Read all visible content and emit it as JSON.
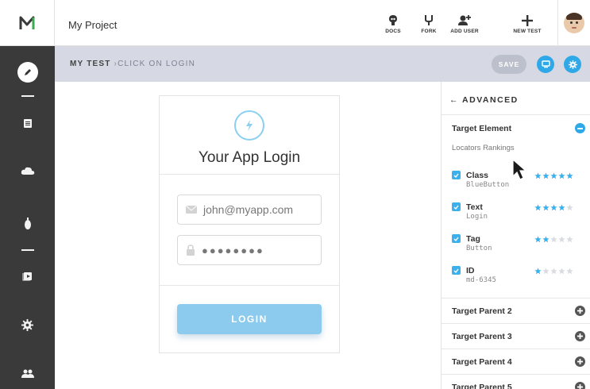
{
  "window": {
    "project_title": "My Project"
  },
  "toolbar": {
    "docs_label": "DOCS",
    "fork_label": "FORK",
    "add_user_label": "ADD USER",
    "new_test_label": "NEW TEST"
  },
  "sidebar": {
    "items": [
      {
        "icon": "pencil-icon"
      },
      {
        "icon": "document-icon"
      },
      {
        "icon": "cloud-icon"
      },
      {
        "icon": "bug-icon"
      },
      {
        "icon": "media-icon"
      },
      {
        "icon": "gear-icon"
      },
      {
        "icon": "users-icon"
      }
    ]
  },
  "subheader": {
    "breadcrumb_root": "MY TEST",
    "breadcrumb_sep": "›",
    "breadcrumb_current": "CLICK ON LOGIN",
    "save_label": "SAVE"
  },
  "login_card": {
    "title": "Your App Login",
    "email_value": "john@myapp.com",
    "password_value": "●●●●●●●●",
    "login_label": "LOGIN"
  },
  "panel": {
    "back_label": "← ADVANCED",
    "target_element_title": "Target Element",
    "locators_label": "Locators Rankings",
    "locators": [
      {
        "name": "Class",
        "value": "BlueButton",
        "rating": 5,
        "checked": true
      },
      {
        "name": "Text",
        "value": "Login",
        "rating": 4,
        "checked": true
      },
      {
        "name": "Tag",
        "value": "Button",
        "rating": 2,
        "checked": true
      },
      {
        "name": "ID",
        "value": "md-6345",
        "rating": 1,
        "checked": true
      }
    ],
    "parents": [
      {
        "label": "Target Parent 2"
      },
      {
        "label": "Target Parent 3"
      },
      {
        "label": "Target Parent 4"
      },
      {
        "label": "Target Parent 5"
      }
    ]
  },
  "colors": {
    "accent": "#2fa8e8",
    "star_on": "#3ab0ec",
    "star_off": "#d9dbe0",
    "sidebar": "#3a3a3a",
    "subheader": "#d6d9e3",
    "logo_green": "#3daa4f"
  }
}
